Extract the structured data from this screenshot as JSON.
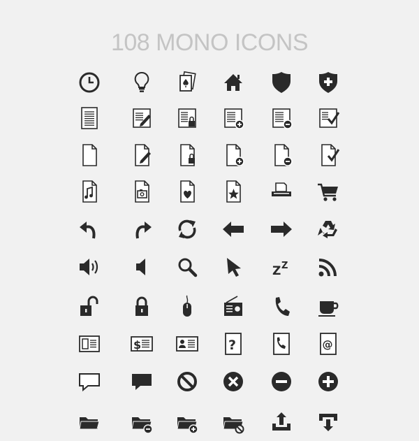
{
  "title": "108 MONO ICONS",
  "colors": {
    "background": "#f1f1f1",
    "icon": "#2a2a2a",
    "title": "#c4c4c4"
  },
  "rows": [
    [
      "clock-icon",
      "lightbulb-icon",
      "playing-cards-icon",
      "home-icon",
      "shield-icon",
      "shield-plus-icon"
    ],
    [
      "document-lines-icon",
      "document-edit-icon",
      "document-lock-icon",
      "document-add-icon",
      "document-remove-icon",
      "document-check-icon"
    ],
    [
      "page-blank-icon",
      "page-edit-icon",
      "page-lock-icon",
      "page-add-icon",
      "page-remove-icon",
      "page-check-icon"
    ],
    [
      "page-music-icon",
      "page-photo-icon",
      "page-heart-icon",
      "page-star-icon",
      "printer-icon",
      "shopping-cart-icon"
    ],
    [
      "undo-arrow-icon",
      "redo-arrow-icon",
      "refresh-icon",
      "arrow-left-icon",
      "arrow-right-icon",
      "recycle-icon"
    ],
    [
      "volume-high-icon",
      "volume-mute-icon",
      "magnifier-icon",
      "cursor-icon",
      "sleep-zz-icon",
      "rss-feed-icon"
    ],
    [
      "unlocked-padlock-icon",
      "locked-padlock-icon",
      "computer-mouse-icon",
      "radio-icon",
      "telephone-icon",
      "coffee-cup-icon"
    ],
    [
      "newspaper-icon",
      "dollar-bill-icon",
      "id-card-icon",
      "help-question-icon",
      "phone-book-icon",
      "email-at-icon"
    ],
    [
      "speech-bubble-outline-icon",
      "speech-bubble-filled-icon",
      "block-forbidden-icon",
      "close-circle-icon",
      "minus-circle-icon",
      "plus-circle-icon"
    ],
    [
      "folder-icon",
      "folder-remove-icon",
      "folder-add-icon",
      "folder-blocked-icon",
      "tray-upload-icon",
      "tray-download-icon"
    ]
  ]
}
